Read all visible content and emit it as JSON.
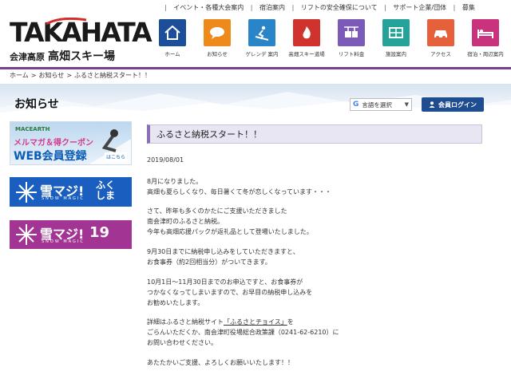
{
  "toplinks": [
    "イベント・各種大会案内",
    "宿泊案内",
    "リフトの安全確保について",
    "サポート企業/団体",
    "募集"
  ],
  "logo": {
    "main": "TAKAHATA",
    "sub": "会津高原",
    "sub_big": "高畑スキー場"
  },
  "nav": [
    {
      "label": "ホーム",
      "icon": "home-icon",
      "color": "#1c4e9a"
    },
    {
      "label": "お知らせ",
      "icon": "speech-bubble-icon",
      "color": "#ee8a1a"
    },
    {
      "label": "ゲレンデ 案内",
      "icon": "skier-icon",
      "color": "#2a84c8"
    },
    {
      "label": "高畑スキー道場",
      "icon": "flame-icon",
      "color": "#d0332e"
    },
    {
      "label": "リフト料金",
      "icon": "lift-icon",
      "color": "#7c5bb8"
    },
    {
      "label": "施設案内",
      "icon": "facility-icon",
      "color": "#23a39a"
    },
    {
      "label": "アクセス",
      "icon": "car-icon",
      "color": "#e6603b"
    },
    {
      "label": "宿泊・周辺案内",
      "icon": "bed-icon",
      "color": "#c9337d"
    }
  ],
  "breadcrumb": {
    "home": "ホーム",
    "news": "お知らせ",
    "current": "ふるさと納税スタート！！",
    "sep": ">"
  },
  "page_heading": "お知らせ",
  "language": {
    "label": "言語を選択",
    "g": "G"
  },
  "login": {
    "label": "会員ログイン"
  },
  "sidebar": {
    "banner1": {
      "brand": "MACEARTH",
      "line1": "メルマガ＆得クーポン",
      "line2": "WEB会員登録",
      "cta": "はこちら"
    },
    "banner2": {
      "title": "雪マジ!",
      "sub": "SNOW MAGIC",
      "right": "ふく\nしま"
    },
    "banner3": {
      "title": "雪マジ!",
      "sub": "SNOW MAGIC",
      "right": "19"
    }
  },
  "article": {
    "title": "ふるさと納税スタート！！",
    "date": "2019/08/01",
    "lines": [
      "8月になりました。",
      "高畑も夏らしくなり、毎日暑くて冬が恋しくなっています・・・",
      "",
      "さて、昨年も多くのかたにご支援いただきました",
      "南会津町のふるさと納税。",
      "今年も高畑応援パックが返礼品として登場いたしました。",
      "",
      "9月30日までに納税申し込みをしていただきますと、",
      "お食事券（約2回相当分）がついてきます。",
      "",
      "10月1日～11月30日までのお申込ですと、お食事券が",
      "つかなくなってしまいますので、お早目の納税申し込みを",
      "お勧めいたします。",
      "",
      "詳細はふるさと納税サイト",
      "ごらんいただくか、南会津町役場総合政策課（0241-62-6210）に",
      "お問い合わせください。",
      "",
      "あたたかいご支援、よろしくお願いいたします！！"
    ],
    "link_text": "「ふるさとチョイス」",
    "link_suffix": "を"
  }
}
